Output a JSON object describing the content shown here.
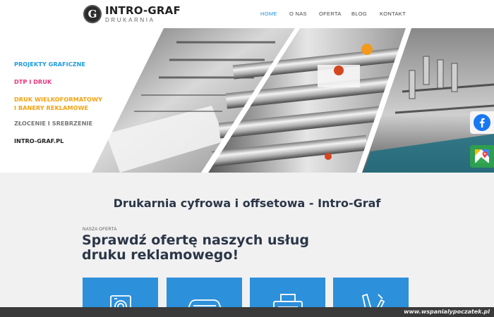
{
  "header": {
    "logo": {
      "mark": "G",
      "title": "INTRO-GRAF",
      "subtitle": "DRUKARNIA"
    },
    "nav": [
      {
        "label": "HOME",
        "active": true
      },
      {
        "label": "O NAS",
        "active": false
      },
      {
        "label": "OFERTA",
        "active": false
      },
      {
        "label": "BLOG",
        "active": false
      },
      {
        "label": "KONTAKT",
        "active": false
      }
    ]
  },
  "hero": {
    "menu": [
      {
        "lines": [
          "PROJEKTY GRAFICZNE"
        ],
        "color": "#1e9ce0"
      },
      {
        "lines": [
          "DTP I DRUK"
        ],
        "color": "#e8347e"
      },
      {
        "lines": [
          "DRUK WIELKOFORMATOWY",
          "I BANERY REKLAMOWE"
        ],
        "color": "#f2a20f"
      },
      {
        "lines": [
          "ZŁOCENIE I SREBRZENIE"
        ],
        "color": "#777777"
      },
      {
        "lines": [
          "INTRO-GRAF.PL"
        ],
        "color": "#222222"
      }
    ],
    "side_buttons": [
      {
        "icon": "facebook-icon"
      },
      {
        "icon": "google-maps-icon"
      }
    ]
  },
  "main": {
    "title": "Drukarnia cyfrowa i offsetowa - Intro-Graf",
    "eyebrow": "NASZA OFERTA",
    "headline": "Sprawdź ofertę naszych usług druku reklamowego!",
    "tiles": [
      {
        "icon": "photo-print-icon"
      },
      {
        "icon": "car-icon"
      },
      {
        "icon": "printer-icon"
      },
      {
        "icon": "pen-tools-icon"
      }
    ],
    "tile_color": "#2d90db"
  },
  "watermark": "www.wspanialypoczatek.pl"
}
